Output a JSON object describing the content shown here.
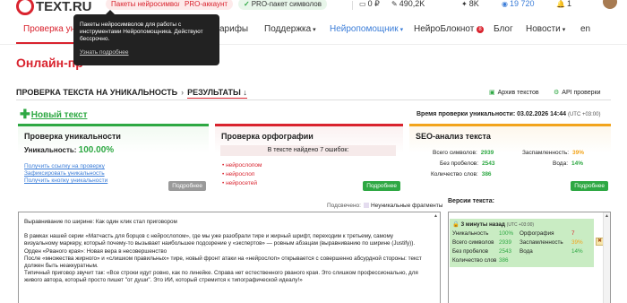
{
  "header": {
    "logo_text": "TEXT.RU",
    "pill_symbols": "Пакеты нейросимволов",
    "pill_pro": "PRO-аккаунт",
    "pill_pro_pack": "PRO-пакет символов",
    "balance": "0 ₽",
    "stat_1": "490,2K",
    "stat_2": "8K",
    "stat_3": "19 720",
    "notifications": "1"
  },
  "nav": {
    "items": [
      "Проверка уни",
      "арифы",
      "Поддержка",
      "Нейропомощник",
      "НейроБлокнот",
      "Блог",
      "Новости",
      "en"
    ],
    "blocknot_badge": "8"
  },
  "tooltip": {
    "text": "Пакеты нейросимволов для работы с инструментами Нейропомощника. Действуют бессрочно.",
    "link": "Узнать подробнее"
  },
  "page": {
    "title": "Онлайн-пр"
  },
  "breadcrumb": {
    "step1": "ПРОВЕРКА ТЕКСТА НА УНИКАЛЬНОСТЬ",
    "arrow": "›",
    "step2": "РЕЗУЛЬТАТЫ ↓"
  },
  "right_links": {
    "archive": "Архив текстов",
    "api": "API проверки"
  },
  "actions": {
    "new_text": "Новый текст"
  },
  "check_time": {
    "label": "Время проверки уникальности: 03.02.2026 14:44",
    "tz": "(UTC +03:00)"
  },
  "cards": {
    "uniqueness": {
      "title": "Проверка уникальности",
      "label": "Уникальность:",
      "value": "100.00%",
      "links": [
        "Получить ссылку на проверку",
        "Зафиксировать уникальность",
        "Получить кнопку уникальности"
      ],
      "more": "Подробнее"
    },
    "spelling": {
      "title": "Проверка орфографии",
      "summary": "В тексте найдено 7 ошибок:",
      "errors": [
        "нейроcлопом",
        "нейроcлоп",
        "нейроcетей"
      ],
      "more": "Подробнее"
    },
    "seo": {
      "title": "SEO-анализ текста",
      "rows": [
        {
          "label": "Всего символов:",
          "value": "2939"
        },
        {
          "label": "Без пробелов:",
          "value": "2543"
        },
        {
          "label": "Количество слов:",
          "value": "386"
        }
      ],
      "water_rows": [
        {
          "label": "Заспамленность:",
          "value": "39%"
        },
        {
          "label": "Вода:",
          "value": "14%"
        }
      ],
      "more": "Подробнее"
    }
  },
  "legend": {
    "shown": "Подсвечено:",
    "unique": "Неуникальные фрагменты"
  },
  "text": {
    "paragraphs": [
      "Выравнивание по ширине: Как один клик стал приговором",
      "В рамках нашей серии «Матчасть для борцов с нейроcлопом», где мы уже разобрали тире и жирный шрифт, переходим к третьему, самому визуальному маркеру, который почему-то вызывает наибольшее подозрение у «экспертов» — ровным абзацам (выравниванию по ширине (Justify)).",
      "Орден «Рваного края»: Новая вера в несовершенство",
      "После «множества жирного» и «слишком правильных» тире, новый фронт атаки на «нейроcлоп» открывается с совершенно абсурдной стороны: текст должен быть неаккуратным.",
      "Типичный приговор звучит так: «Все строки идут ровно, как по линейке. Справа нет естественного рваного края. Это слишком профессионально, для живого автора, который просто пишет \"от души\". Это ИИ, который стремится к типографической идеалу!»"
    ]
  },
  "versions": {
    "label": "Версии текста:",
    "item": {
      "title": "3 минуты назад",
      "tz": "(UTC +03:00)",
      "uniq_label": "Уникальность",
      "uniq_value": "100%",
      "spell_label": "Орфография",
      "spell_value": "7",
      "chars_label": "Всего символов",
      "chars_value": "2939",
      "spam_label": "Заспамленность",
      "spam_value": "39%",
      "nospace_label": "Без пробелов",
      "nospace_value": "2543",
      "water_label": "Вода",
      "water_value": "14%",
      "words_label": "Количество слов",
      "words_value": "386"
    }
  },
  "colors": {
    "accent_red": "#d9232e",
    "success_green": "#2ea843",
    "warning_orange": "#f2a41c",
    "link_blue": "#3b7dd8"
  }
}
